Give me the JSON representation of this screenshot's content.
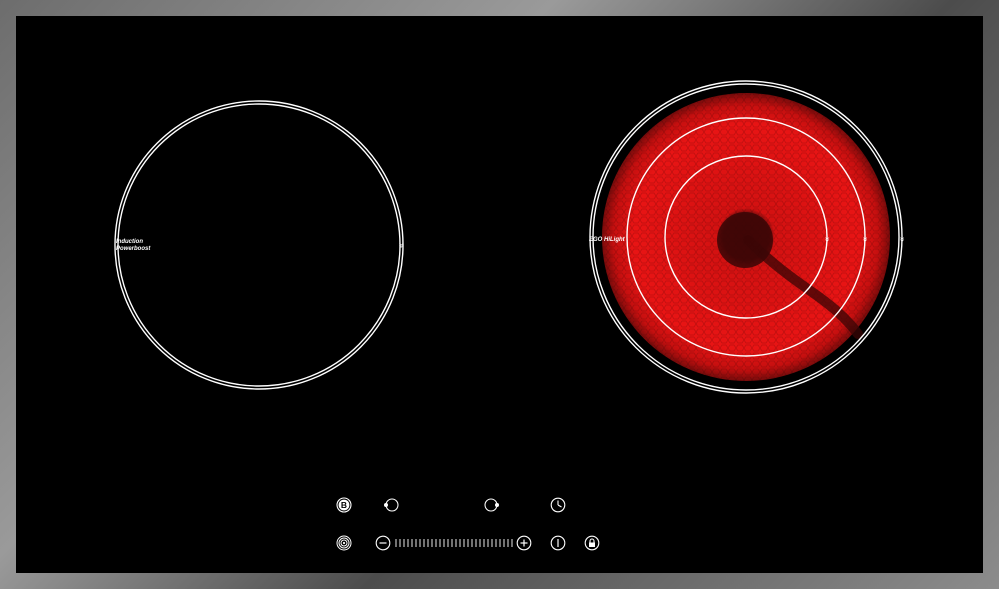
{
  "cooktop": {
    "left_zone": {
      "label_line1": "Induction",
      "label_line2": "Powerboost",
      "state": "off"
    },
    "right_zone": {
      "label": "EGO HiLight",
      "state": "on",
      "glow_color": "#e81414"
    }
  },
  "controls": {
    "row1": [
      {
        "name": "boost-button",
        "icon": "boost-icon"
      },
      {
        "name": "left-zone-select-button",
        "icon": "left-zone-icon"
      },
      {
        "name": "right-zone-select-button",
        "icon": "right-zone-icon"
      },
      {
        "name": "timer-button",
        "icon": "clock-icon"
      }
    ],
    "row2": [
      {
        "name": "dual-zone-button",
        "icon": "dual-ring-icon"
      },
      {
        "name": "minus-button",
        "icon": "minus-icon"
      },
      {
        "name": "power-slider",
        "icon": "slider-icon"
      },
      {
        "name": "plus-button",
        "icon": "plus-icon"
      },
      {
        "name": "power-button",
        "icon": "power-icon"
      },
      {
        "name": "lock-button",
        "icon": "lock-icon"
      }
    ],
    "boost_letter": "B"
  },
  "colors": {
    "glass": "#000000",
    "frame": "#8a8a8a",
    "heating_red": "#e81414",
    "ring_white": "#ffffff"
  }
}
